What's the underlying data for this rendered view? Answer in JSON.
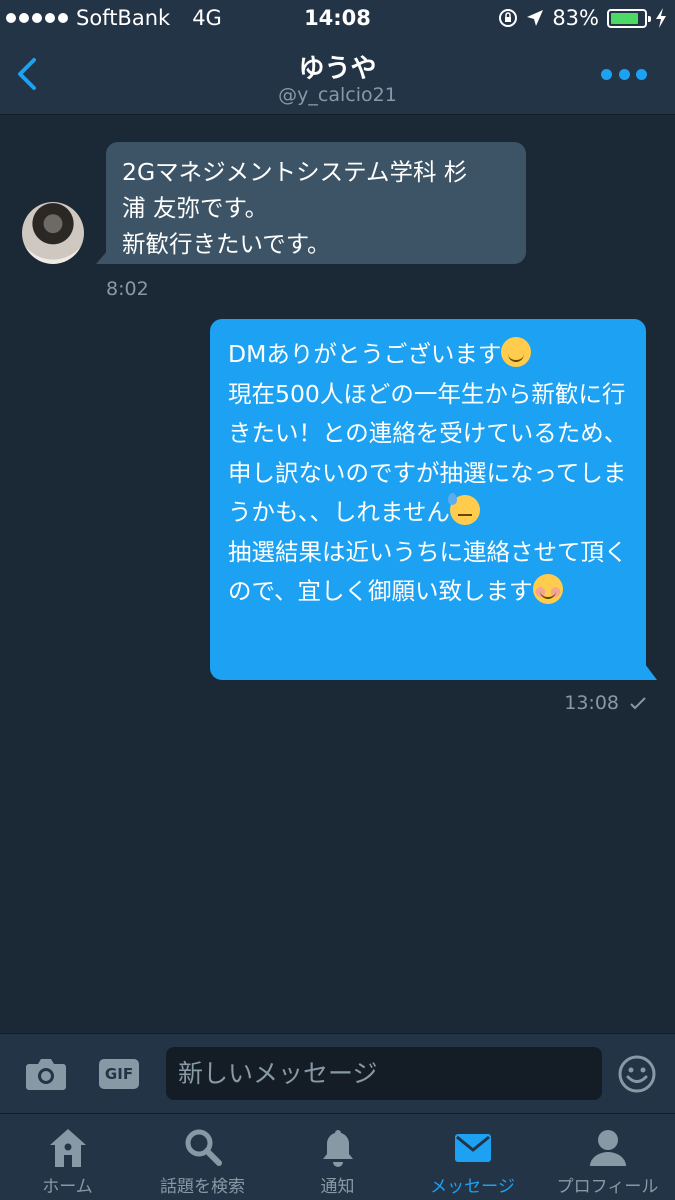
{
  "status_bar": {
    "carrier": "SoftBank",
    "network": "4G",
    "time": "14:08",
    "battery_percent": "83%",
    "battery_level": 0.83
  },
  "header": {
    "title": "ゆうや",
    "handle": "@y_calcio21"
  },
  "messages": {
    "incoming": {
      "lines": [
        "2Gマネジメントシステム学科 杉",
        "浦 友弥です。",
        "新歓行きたいです。"
      ],
      "time": "8:02"
    },
    "outgoing": {
      "line1": "DMありがとうございます",
      "line2": "現在500人ほどの一年生から新歓に行きたい！との連絡を受けているため、申し訳ないのですが抽選になってしまうかも、、しれません",
      "line3": "抽選結果は近いうちに連絡させて頂くので、宜しく御願い致します",
      "time": "13:08"
    }
  },
  "composer": {
    "gif_label": "GIF",
    "placeholder": "新しいメッセージ"
  },
  "tabs": [
    {
      "label": "ホーム",
      "icon": "home-icon"
    },
    {
      "label": "話題を検索",
      "icon": "search-icon"
    },
    {
      "label": "通知",
      "icon": "bell-icon"
    },
    {
      "label": "メッセージ",
      "icon": "envelope-icon",
      "active": true
    },
    {
      "label": "プロフィール",
      "icon": "person-icon"
    }
  ],
  "colors": {
    "background": "#1b2836",
    "bar": "#243447",
    "accent": "#1da1f2",
    "incoming_bubble": "#3d5466",
    "muted_text": "#8899a6"
  }
}
